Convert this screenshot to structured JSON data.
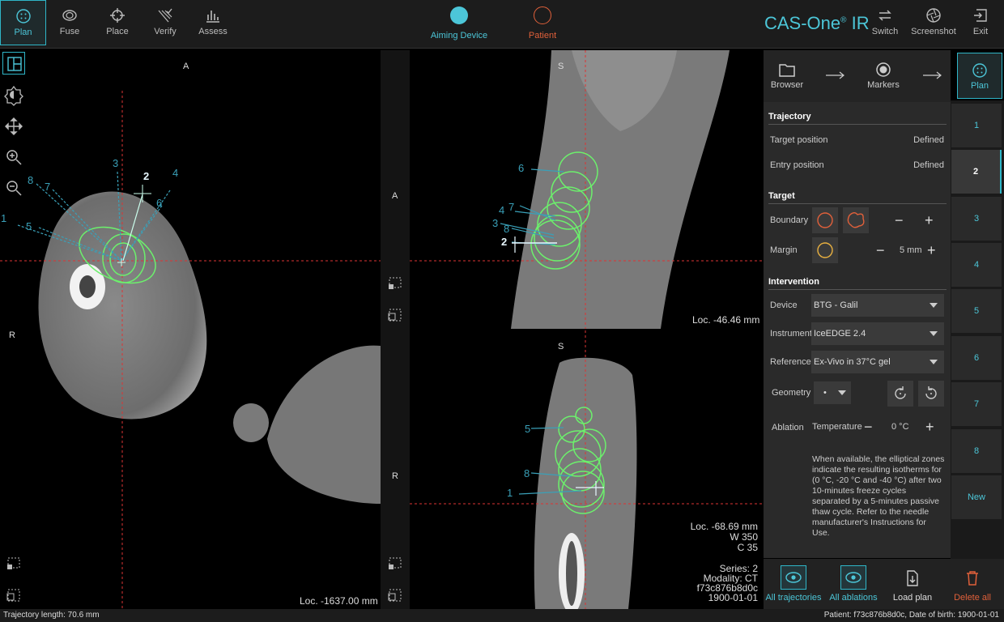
{
  "toolbar": {
    "tabs": [
      {
        "label": "Plan",
        "icon": "plan-icon"
      },
      {
        "label": "Fuse",
        "icon": "fuse-icon"
      },
      {
        "label": "Place",
        "icon": "crosshair-icon"
      },
      {
        "label": "Verify",
        "icon": "verify-icon"
      },
      {
        "label": "Assess",
        "icon": "chart-icon"
      }
    ],
    "aiming_device": "Aiming Device",
    "patient": "Patient",
    "brand": "CAS-One",
    "brand_suffix": "IR",
    "brand_mark": "®",
    "switch": "Switch",
    "screenshot": "Screenshot",
    "exit": "Exit"
  },
  "views": {
    "axial": {
      "top": "A",
      "left": "R",
      "loc": "Loc. -1637.00 mm"
    },
    "sagittal": {
      "top": "S",
      "right": "A",
      "loc": "Loc. -46.46 mm"
    },
    "coronal": {
      "top": "S",
      "left": "R",
      "loc": "Loc. -68.69 mm",
      "window": "W 350",
      "center": "C 35",
      "series": "Series: 2",
      "modality": "Modality: CT",
      "id": "f73c876b8d0c",
      "dob": "1900-01-01"
    }
  },
  "axial_markers": [
    "1",
    "5",
    "8",
    "7",
    "3",
    "2",
    "4",
    "6"
  ],
  "sagittal_markers": [
    "6",
    "4",
    "7",
    "3",
    "8",
    "2"
  ],
  "coronal_markers": [
    "5",
    "8",
    "1"
  ],
  "wizard": {
    "browser": "Browser",
    "markers": "Markers",
    "plan": "Plan"
  },
  "panel": {
    "trajectory": {
      "title": "Trajectory",
      "target_label": "Target position",
      "target_value": "Defined",
      "entry_label": "Entry position",
      "entry_value": "Defined"
    },
    "target": {
      "title": "Target",
      "boundary": "Boundary",
      "margin": "Margin",
      "margin_value": "5 mm"
    },
    "intervention": {
      "title": "Intervention",
      "device_label": "Device",
      "device_value": "BTG - Galil",
      "instrument_label": "Instrument",
      "instrument_value": "IceEDGE 2.4",
      "reference_label": "Reference",
      "reference_value": "Ex-Vivo in 37°C gel",
      "geometry_label": "Geometry",
      "geometry_value": "•",
      "ablation_label": "Ablation",
      "temperature_label": "Temperature",
      "temperature_value": "0 °C",
      "note": "When available, the elliptical zones indicate the resulting isotherms for (0 °C, -20 °C and -40 °C) after two 10-minutes freeze cycles separated by a 5-minutes passive thaw cycle. Refer to the needle manufacturer's Instructions for Use."
    }
  },
  "trajectories": [
    "1",
    "2",
    "3",
    "4",
    "5",
    "6",
    "7",
    "8",
    "New"
  ],
  "bottom": {
    "all_trajectories": "All trajectories",
    "all_ablations": "All ablations",
    "load_plan": "Load plan",
    "delete_all": "Delete all"
  },
  "status": {
    "length": "Trajectory length: 70.6 mm",
    "patient": "Patient: f73c876b8d0c,  Date of birth: 1900-01-01"
  },
  "colors": {
    "accent": "#2fb6c8",
    "patient": "#e0603a",
    "ablation": "#5ee35e",
    "delete": "#e0603a"
  }
}
